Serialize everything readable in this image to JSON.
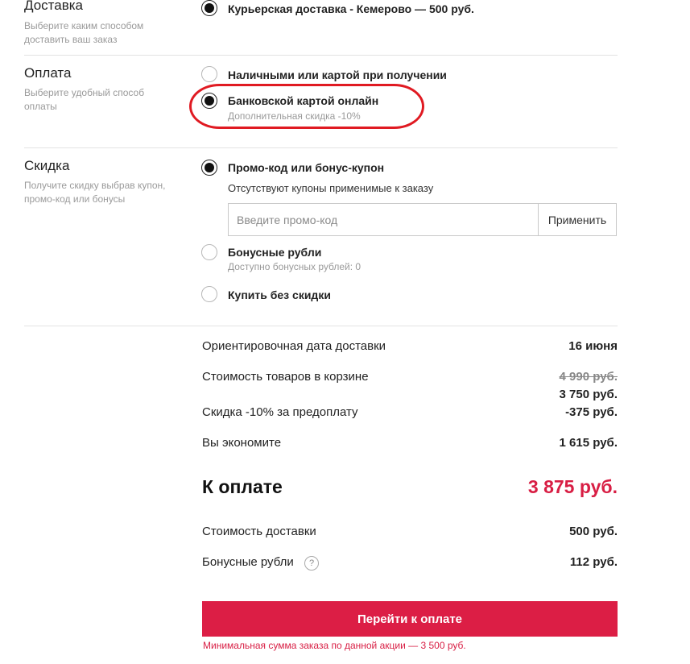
{
  "delivery": {
    "title": "Доставка",
    "description": "Выберите каким способом доставить ваш заказ",
    "option_label": "Курьерская доставка - Кемерово — 500 руб."
  },
  "payment": {
    "title": "Оплата",
    "description": "Выберите удобный способ оплаты",
    "options": [
      {
        "label": "Наличными или картой при получении",
        "selected": false
      },
      {
        "label": "Банковской картой онлайн",
        "sub": "Дополнительная скидка -10%",
        "selected": true
      }
    ]
  },
  "discount": {
    "title": "Скидка",
    "description": "Получите скидку выбрав купон, промо-код или бонусы",
    "options": [
      {
        "label": "Промо-код или бонус-купон",
        "sub": "Отсутствуют купоны применимые к заказу",
        "selected": true
      },
      {
        "label": "Бонусные рубли",
        "sub": "Доступно бонусных рублей: 0",
        "selected": false
      },
      {
        "label": "Купить без скидки",
        "selected": false
      }
    ],
    "promo_placeholder": "Введите промо-код",
    "apply_label": "Применить"
  },
  "summary": {
    "delivery_date_label": "Ориентировочная дата доставки",
    "delivery_date_value": "16 июня",
    "cart_cost_label": "Стоимость товаров в корзине",
    "cart_cost_old": "4 990 руб.",
    "cart_cost_new": "3 750 руб.",
    "prepay_discount_label": "Скидка -10% за предоплату",
    "prepay_discount_value": "-375 руб.",
    "savings_label": "Вы экономите",
    "savings_value": "1 615 руб.",
    "total_label": "К оплате",
    "total_value": "3 875 руб.",
    "shipping_label": "Стоимость доставки",
    "shipping_value": "500 руб.",
    "bonus_label": "Бонусные рубли",
    "bonus_help": "?",
    "bonus_value": "112 руб."
  },
  "checkout": {
    "button_label": "Перейти к оплате",
    "min_order_note": "Минимальная сумма заказа по данной акции — 3 500 руб."
  },
  "colors": {
    "accent": "#dc1e45",
    "highlight": "#e01a22"
  }
}
